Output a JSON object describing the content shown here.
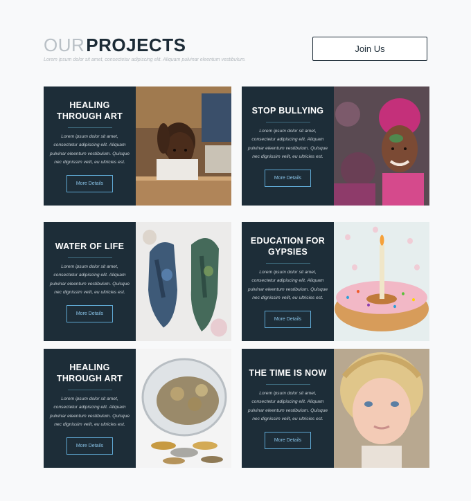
{
  "header": {
    "title_light": "OUR",
    "title_bold": "PROJECTS",
    "subtitle": "Lorem ipsum dolor sit amet, consectetur adipiscing elit. Aliquam pulvinar eleentum vestibulum.",
    "join_label": "Join Us"
  },
  "projects": [
    {
      "title": "HEALING THROUGH ART",
      "body": "Lorem ipsum dolor sit amet, consectetur adipiscing elit. Aliquam pulvinar eleentum vestibulum. Quisque nec dignissim velit, eu ultricies est.",
      "button": "More Details",
      "image": "child-in-classroom-photo"
    },
    {
      "title": "STOP BULLYING",
      "body": "Lorem ipsum dolor sit amet, consectetur adipiscing elit. Aliquam pulvinar eleentum vestibulum. Quisque nec dignissim velit, eu ultricies est.",
      "button": "More Details",
      "image": "girl-with-color-powder-photo"
    },
    {
      "title": "WATER OF LIFE",
      "body": "Lorem ipsum dolor sit amet, consectetur adipiscing elit. Aliquam pulvinar eleentum vestibulum. Quisque nec dignissim velit, eu ultricies est.",
      "button": "More Details",
      "image": "painted-hands-photo"
    },
    {
      "title": "EDUCATION FOR GYPSIES",
      "body": "Lorem ipsum dolor sit amet, consectetur adipiscing elit. Aliquam pulvinar eleentum vestibulum. Quisque nec dignissim velit, eu ultricies est.",
      "button": "More Details",
      "image": "donut-with-candle-photo"
    },
    {
      "title": "HEALING THROUGH ART",
      "body": "Lorem ipsum dolor sit amet, consectetur adipiscing elit. Aliquam pulvinar eleentum vestibulum. Quisque nec dignissim velit, eu ultricies est.",
      "button": "More Details",
      "image": "coins-in-jar-photo"
    },
    {
      "title": "THE TIME IS NOW",
      "body": "Lorem ipsum dolor sit amet, consectetur adipiscing elit. Aliquam pulvinar eleentum vestibulum. Quisque nec dignissim velit, eu ultricies est.",
      "button": "More Details",
      "image": "blonde-toddler-photo"
    }
  ],
  "colors": {
    "panel": "#1d2d38",
    "accent": "#5fa8d3",
    "title_dark": "#1c2b36"
  }
}
